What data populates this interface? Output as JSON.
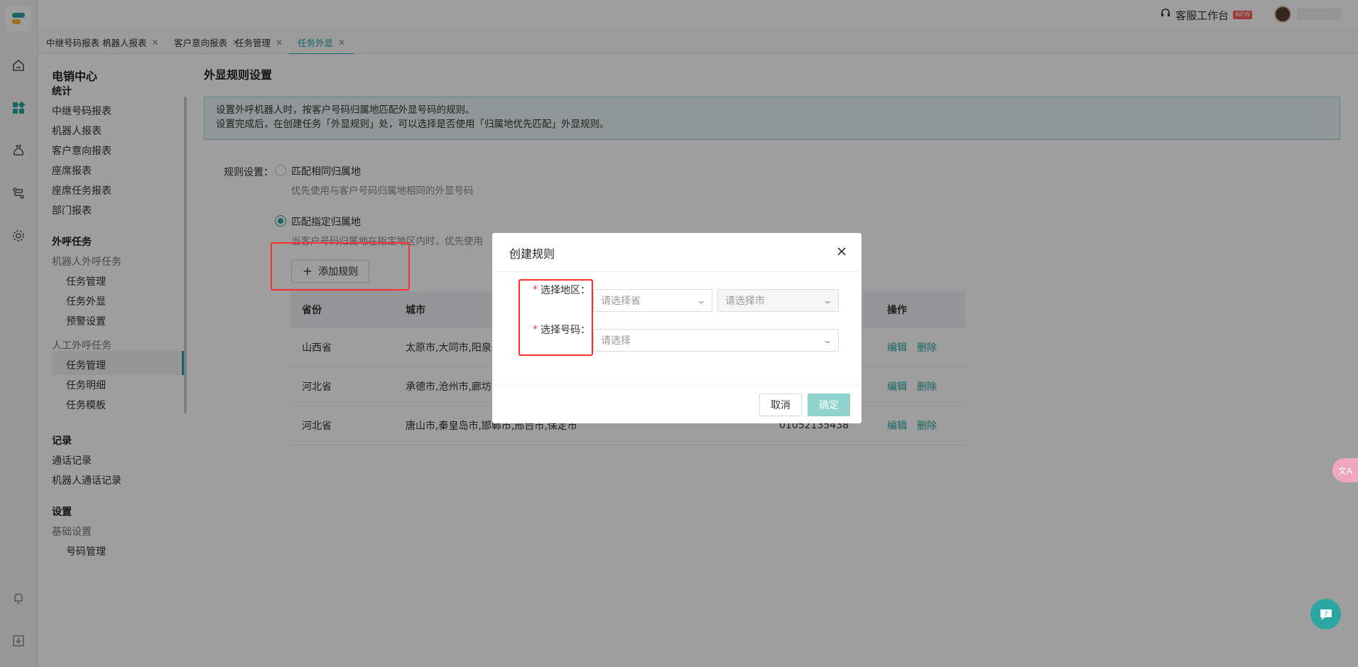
{
  "app": {
    "service_label": "客服工作台",
    "new_badge": "NEW"
  },
  "tabs": [
    {
      "label": "中继号码报表"
    },
    {
      "label": "机器人报表"
    },
    {
      "label": "客户意向报表"
    },
    {
      "label": "任务管理"
    },
    {
      "label": "任务外显"
    }
  ],
  "sidebar": {
    "title": "电销中心",
    "items": [
      {
        "label": "统计"
      },
      {
        "label": "中继号码报表"
      },
      {
        "label": "机器人报表"
      },
      {
        "label": "客户意向报表"
      },
      {
        "label": "座席报表"
      },
      {
        "label": "座席任务报表"
      },
      {
        "label": "部门报表"
      },
      {
        "label": "外呼任务"
      },
      {
        "label": "机器人外呼任务"
      },
      {
        "label": "任务管理"
      },
      {
        "label": "任务外显"
      },
      {
        "label": "预警设置"
      },
      {
        "label": "人工外呼任务"
      },
      {
        "label": "任务管理"
      },
      {
        "label": "任务明细"
      },
      {
        "label": "任务模板"
      },
      {
        "label": "记录"
      },
      {
        "label": "通话记录"
      },
      {
        "label": "机器人通话记录"
      },
      {
        "label": "设置"
      },
      {
        "label": "基础设置"
      },
      {
        "label": "号码管理"
      }
    ]
  },
  "main": {
    "title": "外显规则设置",
    "notice_line1": "设置外呼机器人时，按客户号码归属地匹配外显号码的规则。",
    "notice_line2": "设置完成后，在创建任务「外显规则」处，可以选择是否使用「归属地优先匹配」外显规则。",
    "rule_label": "规则设置：",
    "option1_label": "匹配相同归属地",
    "option1_desc": "优先使用与客户号码归属地相同的外显号码",
    "option2_label": "匹配指定归属地",
    "option2_desc": "当客户号码归属地在指定地区内时，优先使用",
    "add_rule": "添加规则",
    "table": {
      "headers": {
        "province": "省份",
        "city": "城市",
        "action": "操作"
      },
      "rows": [
        {
          "province": "山西省",
          "city": "太原市,大同市,阳泉",
          "number": "",
          "edit": "编辑",
          "delete": "删除"
        },
        {
          "province": "河北省",
          "city": "承德市,沧州市,廊坊",
          "number": "",
          "edit": "编辑",
          "delete": "删除"
        },
        {
          "province": "河北省",
          "city": "唐山市,秦皇岛市,邯郸市,邢台市,保定市",
          "number": "01052135438",
          "edit": "编辑",
          "delete": "删除"
        }
      ]
    }
  },
  "dialog": {
    "title": "创建规则",
    "region_label": "选择地区：",
    "province_placeholder": "请选择省",
    "city_placeholder": "请选择市",
    "number_label": "选择号码：",
    "number_placeholder": "请选择",
    "cancel": "取消",
    "confirm": "确定"
  },
  "translate_label": "文A"
}
